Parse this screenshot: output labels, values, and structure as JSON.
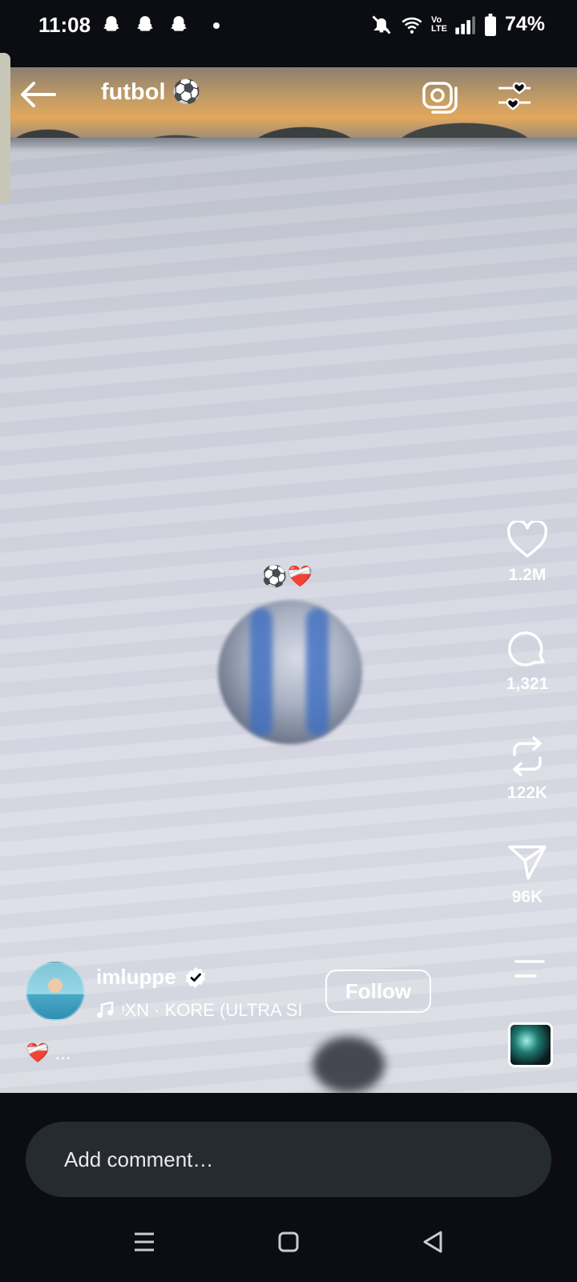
{
  "status_bar": {
    "time": "11:08",
    "battery": "74%",
    "icons": [
      "snapchat-icon",
      "snapchat-icon",
      "snapchat-icon",
      "notification-dot",
      "mute-icon",
      "wifi-icon",
      "volte-icon",
      "signal-icon",
      "battery-icon"
    ],
    "volte_label": "Vo LTE"
  },
  "header": {
    "title": "futbol ⚽",
    "back_icon": "back-arrow-icon",
    "camera_icon": "camera-icon",
    "filter_icon": "heart-filter-icon"
  },
  "video": {
    "overlay_text": "⚽❤️‍🩹"
  },
  "actions": {
    "likes": "1.2M",
    "comments": "1,321",
    "reposts": "122K",
    "shares": "96K"
  },
  "post": {
    "username": "imluppe",
    "song": "ᵎXN · KORE (ULTRA SI",
    "follow_label": "Follow",
    "caption": "❤️‍🩹 ..."
  },
  "comment": {
    "placeholder": "Add comment…"
  },
  "colors": {
    "background": "#0b0d12",
    "comment_box": "#262a31",
    "text": "#ffffff"
  }
}
